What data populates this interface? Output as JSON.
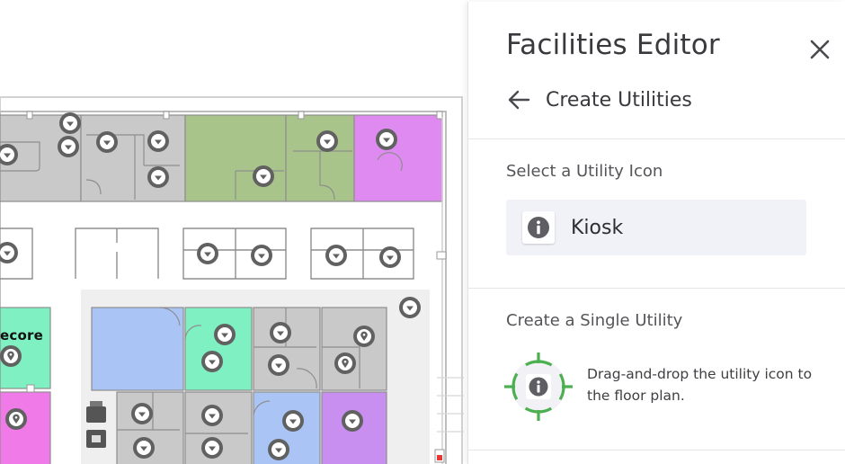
{
  "floorplan": {
    "room_label": "ecore",
    "colors": {
      "gray": "#c9c9c9",
      "green": "#a8c48a",
      "magenta": "#df8af0",
      "mint": "#7ff0c2",
      "blue": "#aac5f5",
      "purple": "#c88ef0",
      "pink": "#f07ae8"
    }
  },
  "panel": {
    "title": "Facilities Editor",
    "close_icon": "close-icon",
    "back_icon": "arrow-left-icon",
    "subtitle": "Create Utilities",
    "select_section": {
      "label": "Select a Utility Icon",
      "selected_name": "Kiosk",
      "selected_icon": "info-icon"
    },
    "create_section": {
      "label": "Create a Single Utility",
      "instruction": "Drag-and-drop the utility icon to the floor plan.",
      "accent": "#4caf50"
    }
  }
}
